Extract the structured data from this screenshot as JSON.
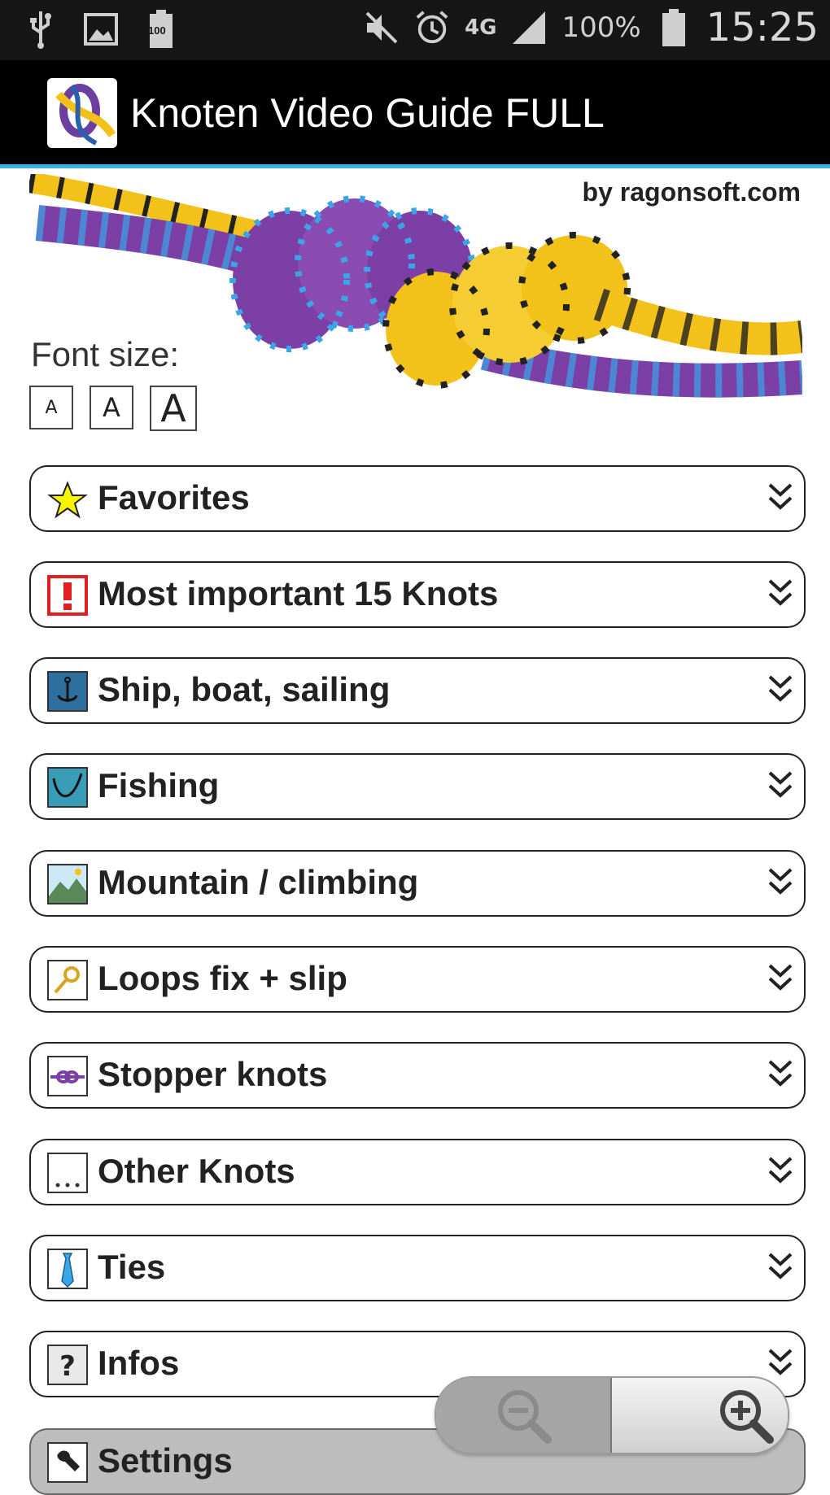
{
  "status_bar": {
    "battery_icon_label": "100",
    "network": "4G",
    "battery": "100%",
    "time": "15:25"
  },
  "action_bar": {
    "title": "Knoten Video Guide FULL"
  },
  "header": {
    "byline": "by ragonsoft.com",
    "font_size_label": "Font size:",
    "font_buttons": [
      "A",
      "A",
      "A"
    ]
  },
  "categories": [
    {
      "label": "Favorites",
      "icon": "star-icon"
    },
    {
      "label": "Most important 15 Knots",
      "icon": "exclamation-icon"
    },
    {
      "label": "Ship, boat, sailing",
      "icon": "anchor-icon"
    },
    {
      "label": "Fishing",
      "icon": "fishing-hook-icon"
    },
    {
      "label": "Mountain / climbing",
      "icon": "mountain-icon"
    },
    {
      "label": "Loops fix + slip",
      "icon": "loop-icon"
    },
    {
      "label": "Stopper knots",
      "icon": "stopper-knot-icon"
    },
    {
      "label": "Other Knots",
      "icon": "ellipsis-icon"
    },
    {
      "label": "Ties",
      "icon": "necktie-icon"
    },
    {
      "label": "Infos",
      "icon": "question-icon"
    }
  ],
  "settings": {
    "label": "Settings",
    "icon": "wrench-icon"
  },
  "colors": {
    "accent": "#33b5e5",
    "rope_purple": "#7b3fa6",
    "rope_yellow": "#f2c21b"
  }
}
